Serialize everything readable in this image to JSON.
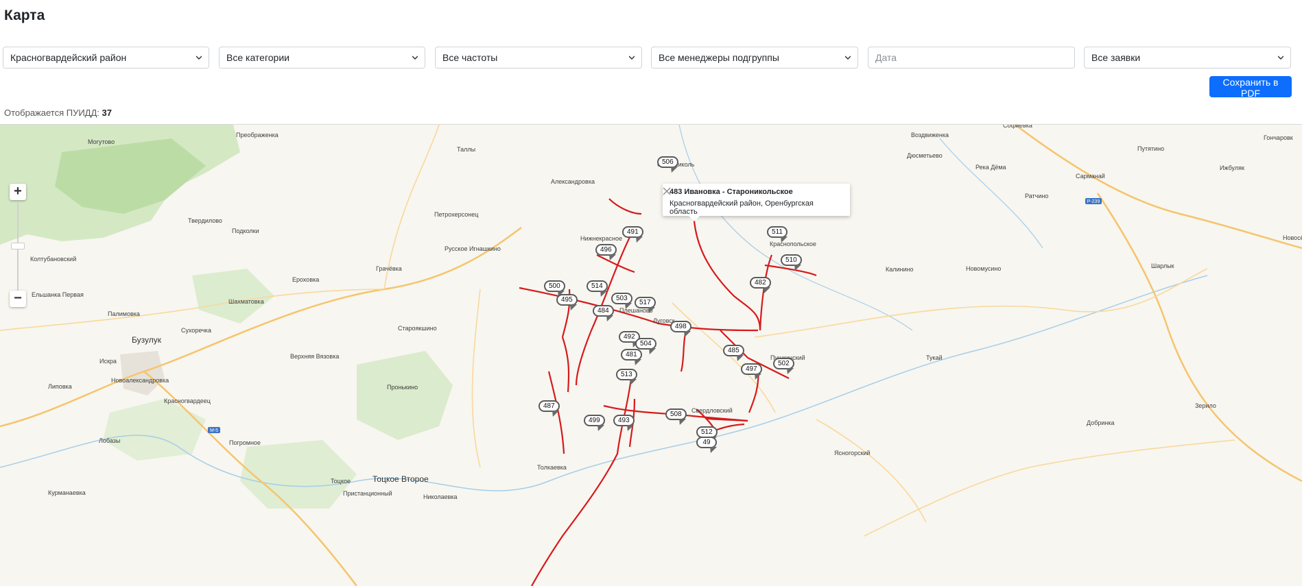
{
  "page": {
    "title": "Карта"
  },
  "filters": {
    "district": "Красногвардейский район",
    "category": "Все категории",
    "frequency": "Все частоты",
    "manager": "Все менеджеры подгруппы",
    "date_placeholder": "Дата",
    "requests": "Все заявки"
  },
  "actions": {
    "save_pdf": "Сохранить в PDF"
  },
  "status": {
    "label": "Отображается ПУИДД:",
    "count": "37"
  },
  "popup": {
    "title": "483 Ивановка - Староникольское",
    "subtitle": "Красногвардейский район, Оренбургская область"
  },
  "map": {
    "zoom_in": "+",
    "zoom_out": "−",
    "road_signs": [
      "М-5",
      "Р-239"
    ],
    "place_labels": [
      "Преображенка",
      "Могутово",
      "Таллы",
      "Воздвиженка",
      "Софиевка",
      "Гончаровк",
      "Путятино",
      "Дюсметьево",
      "Река Дёма",
      "Сарманай",
      "Ижбуляк",
      "Ратчино",
      "Александровка",
      "Твердилово",
      "Подколки",
      "Петрохерсонец",
      "Колтубановский",
      "Русское Игнашкино",
      "Грачёвка",
      "Ероховка",
      "Ельшанка Первая",
      "Шахматовка",
      "Палимовка",
      "Бузулук",
      "Сухоречка",
      "Староякшино",
      "Верхняя Вязовка",
      "Искра",
      "Новоалександровка",
      "Липовка",
      "Красногвардеец",
      "Пронькино",
      "Погромное",
      "Лобазы",
      "Тоцкое",
      "Тоцкое Второе",
      "Пристанционный",
      "Николаевка",
      "Курманаевка",
      "Толкаевка",
      "Свердловский",
      "Ясногорский",
      "Пушкинский",
      "Калинино",
      "Новомусино",
      "Шарлык",
      "Новосёлк",
      "Тукай",
      "Добринка",
      "Зерило",
      "Плешаново",
      "Луговск",
      "Нижнекрасное",
      "Старониколь",
      "Краснопольское"
    ],
    "marker_labels": [
      "506",
      "491",
      "496",
      "511",
      "510",
      "482",
      "500",
      "514",
      "495",
      "484",
      "503",
      "517",
      "498",
      "492",
      "504",
      "481",
      "485",
      "502",
      "497",
      "513",
      "487",
      "499",
      "493",
      "508",
      "512",
      "49"
    ]
  }
}
